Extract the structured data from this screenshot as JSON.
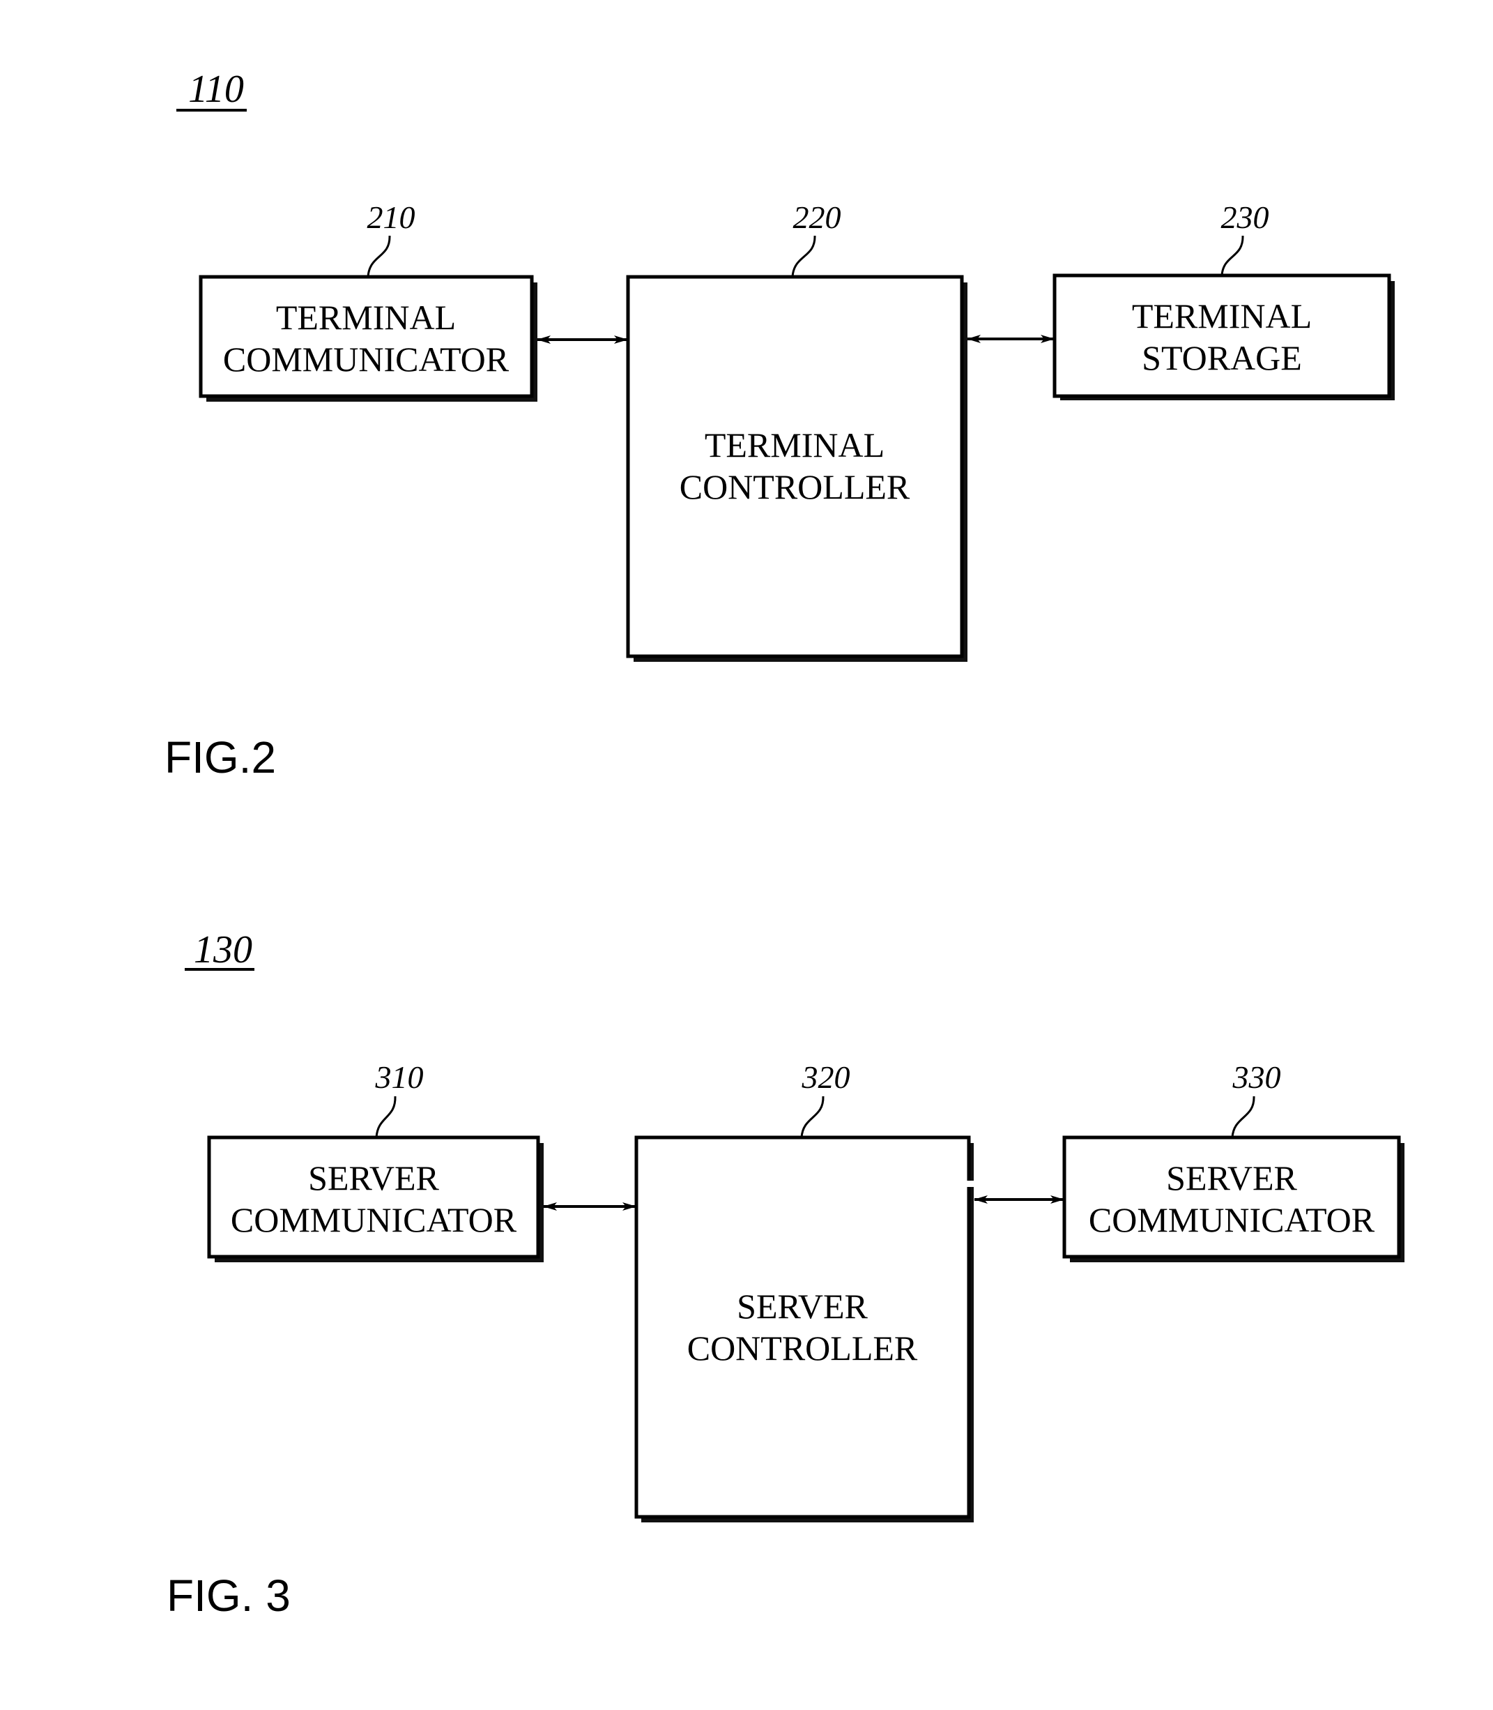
{
  "figures": [
    {
      "id": "fig2",
      "caption": "FIG.2",
      "reference": "110",
      "blocks": [
        {
          "id": "terminal-communicator",
          "ref": "210",
          "lines": [
            "TERMINAL",
            "COMMUNICATOR"
          ]
        },
        {
          "id": "terminal-controller",
          "ref": "220",
          "lines": [
            "TERMINAL",
            "CONTROLLER"
          ]
        },
        {
          "id": "terminal-storage",
          "ref": "230",
          "lines": [
            "TERMINAL",
            "STORAGE"
          ]
        }
      ],
      "connections": [
        {
          "from": "terminal-communicator",
          "to": "terminal-controller",
          "direction": "bidirectional"
        },
        {
          "from": "terminal-controller",
          "to": "terminal-storage",
          "direction": "bidirectional"
        }
      ]
    },
    {
      "id": "fig3",
      "caption": "FIG. 3",
      "reference": "130",
      "blocks": [
        {
          "id": "server-communicator-left",
          "ref": "310",
          "lines": [
            "SERVER",
            "COMMUNICATOR"
          ]
        },
        {
          "id": "server-controller",
          "ref": "320",
          "lines": [
            "SERVER",
            "CONTROLLER"
          ]
        },
        {
          "id": "server-communicator-right",
          "ref": "330",
          "lines": [
            "SERVER",
            "COMMUNICATOR"
          ]
        }
      ],
      "connections": [
        {
          "from": "server-communicator-left",
          "to": "server-controller",
          "direction": "bidirectional"
        },
        {
          "from": "server-controller",
          "to": "server-communicator-right",
          "direction": "bidirectional"
        }
      ]
    }
  ]
}
